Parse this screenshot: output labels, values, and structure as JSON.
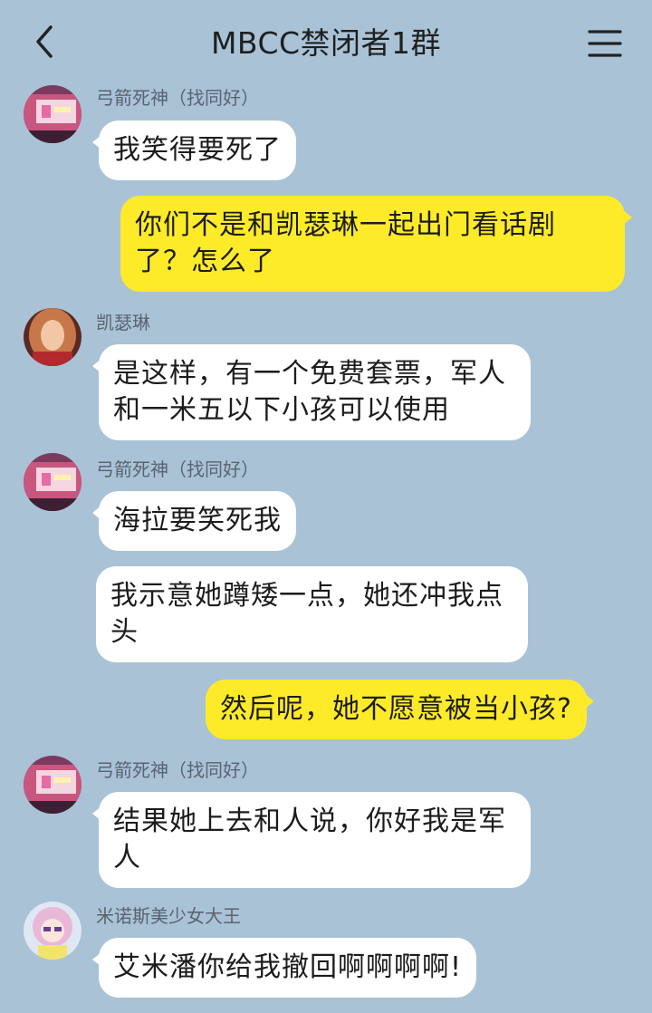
{
  "header": {
    "title": "MBCC禁闭者1群",
    "back_icon": "chevron-left-icon",
    "menu_icon": "hamburger-menu-icon"
  },
  "messages": [
    {
      "sender": "弓箭死神（找同好）",
      "text": "我笑得要死了"
    },
    {
      "sender": "",
      "text": "你们不是和凯瑟琳一起出门看话剧了？怎么了"
    },
    {
      "sender": "凯瑟琳",
      "text": "是这样，有一个免费套票，军人和一米五以下小孩可以使用"
    },
    {
      "sender": "弓箭死神（找同好）",
      "text": "海拉要笑死我"
    },
    {
      "sender": "弓箭死神（找同好）",
      "text": "我示意她蹲矮一点，她还冲我点头"
    },
    {
      "sender": "",
      "text": "然后呢，她不愿意被当小孩?"
    },
    {
      "sender": "弓箭死神（找同好）",
      "text": "结果她上去和人说，你好我是军人"
    },
    {
      "sender": "米诺斯美少女大王",
      "text": "艾米潘你给我撤回啊啊啊啊!"
    }
  ],
  "colors": {
    "background": "#a9c2d6",
    "incoming_bubble": "#ffffff",
    "outgoing_bubble": "#fdeb29"
  }
}
